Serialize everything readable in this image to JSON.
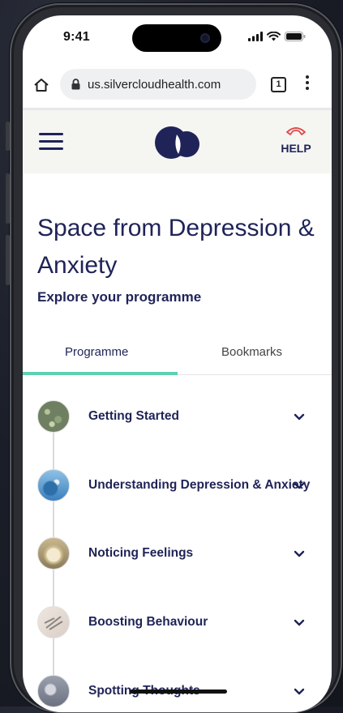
{
  "status_bar": {
    "time": "9:41"
  },
  "browser": {
    "url": "us.silvercloudhealth.com",
    "tab_count": "1"
  },
  "header": {
    "help_label": "HELP"
  },
  "page": {
    "title": "Space from Depression & Anxiety",
    "subtitle": "Explore your programme"
  },
  "tabs": [
    {
      "label": "Programme",
      "active": true
    },
    {
      "label": "Bookmarks",
      "active": false
    }
  ],
  "modules": [
    {
      "label": "Getting Started"
    },
    {
      "label": "Understanding Depression & Anxiety"
    },
    {
      "label": "Noticing Feelings"
    },
    {
      "label": "Boosting Behaviour"
    },
    {
      "label": "Spotting Thoughts"
    }
  ],
  "colors": {
    "brand_navy": "#1f2357",
    "accent_teal": "#5fd0b2",
    "help_red": "#e0484a"
  },
  "icons": [
    "home-icon",
    "lock-icon",
    "tabs-icon",
    "menu-dots-icon",
    "hamburger-icon",
    "logo",
    "phone-icon",
    "chevron-down-icon"
  ]
}
